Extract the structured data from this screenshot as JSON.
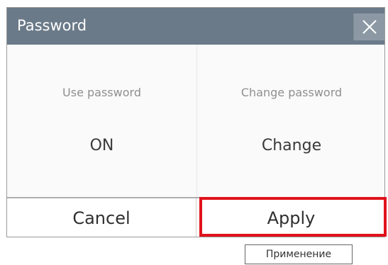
{
  "dialog": {
    "title": "Password",
    "close_icon": "close-icon"
  },
  "options": [
    {
      "label": "Use password",
      "value": "ON"
    },
    {
      "label": "Change password",
      "value": "Change"
    }
  ],
  "footer": {
    "cancel_label": "Cancel",
    "apply_label": "Apply"
  },
  "annotation": {
    "highlight_color": "#e0121c",
    "callout_text": "Применение"
  }
}
